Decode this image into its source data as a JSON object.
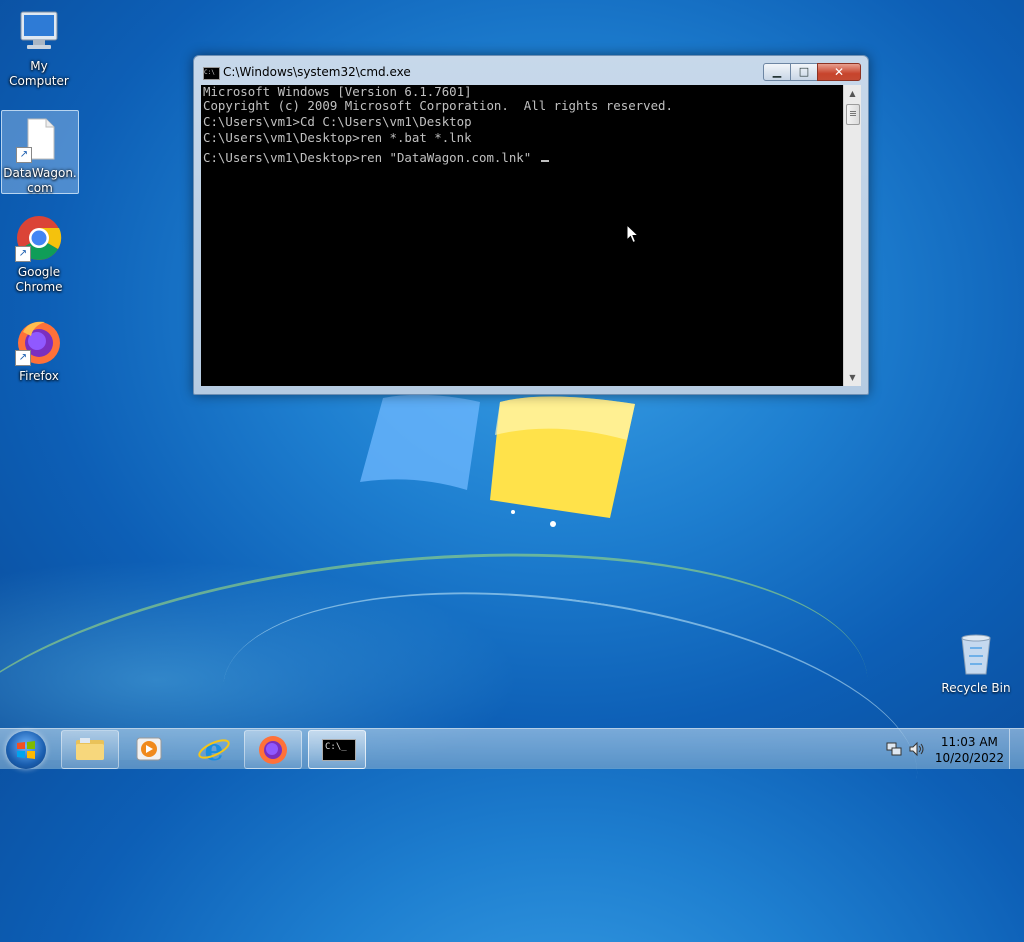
{
  "desktop": {
    "icons": [
      {
        "label": "My Computer"
      },
      {
        "label": "DataWagon.com"
      },
      {
        "label": "Google Chrome"
      },
      {
        "label": "Firefox"
      }
    ],
    "recycle_bin": {
      "label": "Recycle Bin"
    }
  },
  "cmd_window": {
    "title": "C:\\Windows\\system32\\cmd.exe",
    "title_icon_text": "C:\\",
    "lines": [
      "Microsoft Windows [Version 6.1.7601]",
      "Copyright (c) 2009 Microsoft Corporation.  All rights reserved.",
      "",
      "C:\\Users\\vm1>Cd C:\\Users\\vm1\\Desktop",
      "",
      "C:\\Users\\vm1\\Desktop>ren *.bat *.lnk",
      "",
      "C:\\Users\\vm1\\Desktop>ren \"DataWagon.com.lnk\" "
    ],
    "buttons": {
      "minimize": "▁",
      "maximize": "□",
      "close": "✕"
    }
  },
  "taskbar": {
    "clock_time": "11:03 AM",
    "clock_date": "10/20/2022",
    "cmd_button_text": "C:\\_"
  }
}
